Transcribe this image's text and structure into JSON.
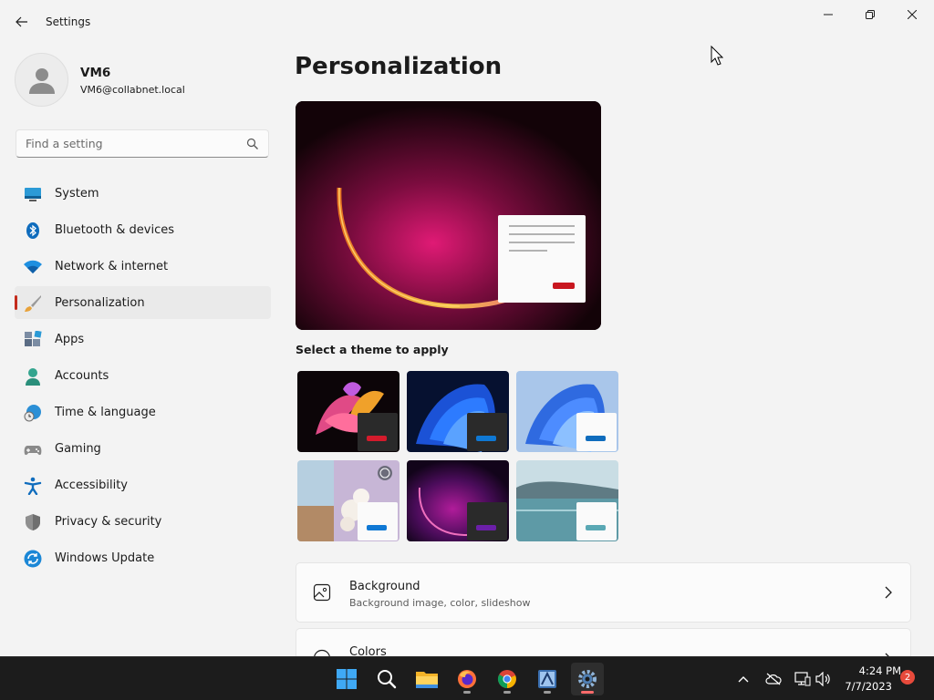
{
  "window": {
    "title": "Settings"
  },
  "profile": {
    "name": "VM6",
    "email": "VM6@collabnet.local"
  },
  "search": {
    "placeholder": "Find a setting"
  },
  "sidebar": {
    "items": [
      {
        "label": "System",
        "icon": "monitor-icon"
      },
      {
        "label": "Bluetooth & devices",
        "icon": "bluetooth-icon"
      },
      {
        "label": "Network & internet",
        "icon": "wifi-icon"
      },
      {
        "label": "Personalization",
        "icon": "brush-icon",
        "active": true
      },
      {
        "label": "Apps",
        "icon": "apps-icon"
      },
      {
        "label": "Accounts",
        "icon": "person-icon"
      },
      {
        "label": "Time & language",
        "icon": "globe-clock-icon"
      },
      {
        "label": "Gaming",
        "icon": "gamepad-icon"
      },
      {
        "label": "Accessibility",
        "icon": "accessibility-icon"
      },
      {
        "label": "Privacy & security",
        "icon": "shield-icon"
      },
      {
        "label": "Windows Update",
        "icon": "update-icon"
      }
    ]
  },
  "main": {
    "title": "Personalization",
    "theme_heading": "Select a theme to apply",
    "themes": [
      {
        "name": "flower-theme",
        "accent": "#d41b2c",
        "mode": "dark"
      },
      {
        "name": "windows-dark-theme",
        "accent": "#0f78d4",
        "mode": "dark"
      },
      {
        "name": "windows-light-theme",
        "accent": "#0f6cbd",
        "mode": "light"
      },
      {
        "name": "spotlight-theme",
        "accent": "#0f78d4",
        "mode": "light"
      },
      {
        "name": "glow-theme",
        "accent": "#6b1fa8",
        "mode": "dark"
      },
      {
        "name": "lake-theme",
        "accent": "#5aa8b4",
        "mode": "light"
      }
    ],
    "cards": [
      {
        "title": "Background",
        "subtitle": "Background image, color, slideshow"
      },
      {
        "title": "Colors",
        "subtitle": ""
      }
    ]
  },
  "taskbar": {
    "apps": [
      "start-icon",
      "search-icon",
      "file-explorer-icon",
      "firefox-icon",
      "chrome-icon",
      "app-icon",
      "settings-icon"
    ],
    "time": "4:24 PM",
    "date": "7/7/2023",
    "notifications": "2"
  },
  "colors": {
    "accent": "#c42b1c",
    "window_bg": "#f3f3f3",
    "taskbar_bg": "#1c1c1c"
  }
}
